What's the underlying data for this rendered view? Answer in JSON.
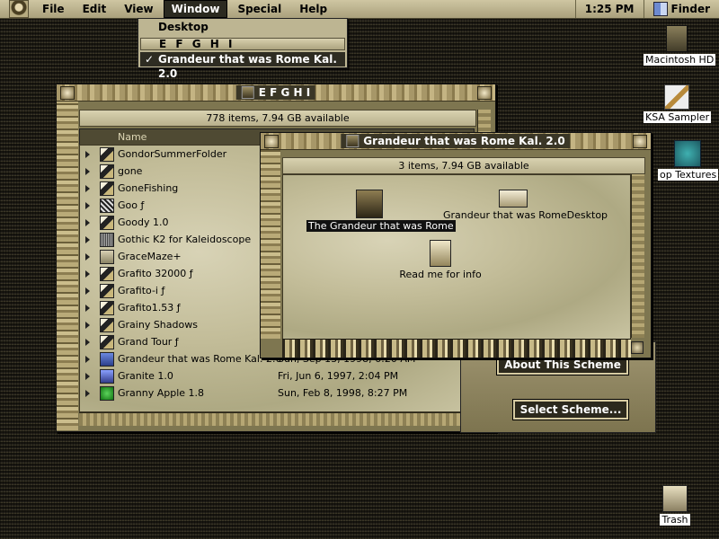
{
  "menubar": {
    "menus": [
      "File",
      "Edit",
      "View",
      "Window",
      "Special",
      "Help"
    ],
    "clock": "1:25 PM",
    "app_name": "Finder"
  },
  "window_menu": {
    "items": [
      "Desktop",
      "E F G H I",
      "Grandeur that was Rome Kal. 2.0"
    ],
    "check": "✓"
  },
  "desktop_icons": {
    "hd": "Macintosh HD",
    "ksa": "KSA Sampler",
    "textures": "op Textures",
    "trash": "Trash"
  },
  "window_efghi": {
    "title": "E F G H I",
    "status": "778 items, 7.94 GB available",
    "column_name": "Name",
    "rows": [
      {
        "name": "GondorSummerFolder",
        "date": "",
        "icon": "suit"
      },
      {
        "name": "gone",
        "date": "",
        "icon": "suit"
      },
      {
        "name": "GoneFishing",
        "date": "",
        "icon": "suit"
      },
      {
        "name": "Goo ƒ",
        "date": "",
        "icon": "app"
      },
      {
        "name": "Goody 1.0",
        "date": "",
        "icon": "suit"
      },
      {
        "name": "Gothic K2 for Kaleidoscope",
        "date": "",
        "icon": "grain"
      },
      {
        "name": "GraceMaze+",
        "date": "",
        "icon": "folder"
      },
      {
        "name": "Grafito 32000 ƒ",
        "date": "",
        "icon": "suit"
      },
      {
        "name": "Grafito-i ƒ",
        "date": "",
        "icon": "suit"
      },
      {
        "name": "Grafito1.53 ƒ",
        "date": "",
        "icon": "suit"
      },
      {
        "name": "Grainy Shadows",
        "date": "",
        "icon": "suit"
      },
      {
        "name": "Grand Tour ƒ",
        "date": "",
        "icon": "suit"
      },
      {
        "name": "Grandeur that was Rome Kal. 2.0",
        "date": "Sun, Sep 13, 1998, 6:20 AM",
        "icon": "kal"
      },
      {
        "name": "Granite 1.0",
        "date": "Fri, Jun 6, 1997, 2:04 PM",
        "icon": "blu"
      },
      {
        "name": "Granny Apple 1.8",
        "date": "Sun, Feb 8, 1998, 8:27 PM",
        "icon": "apple2"
      }
    ]
  },
  "window_rome": {
    "title": "Grandeur that was Rome Kal. 2.0",
    "status": "3 items, 7.94 GB available",
    "files": [
      {
        "label": "The Grandeur that was Rome",
        "selected": true
      },
      {
        "label": "Grandeur that was RomeDesktop",
        "selected": false
      },
      {
        "label": "Read me for info",
        "selected": false
      }
    ]
  },
  "scheme_panel": {
    "about_label": "About This Scheme",
    "select_label": "Select Scheme..."
  }
}
